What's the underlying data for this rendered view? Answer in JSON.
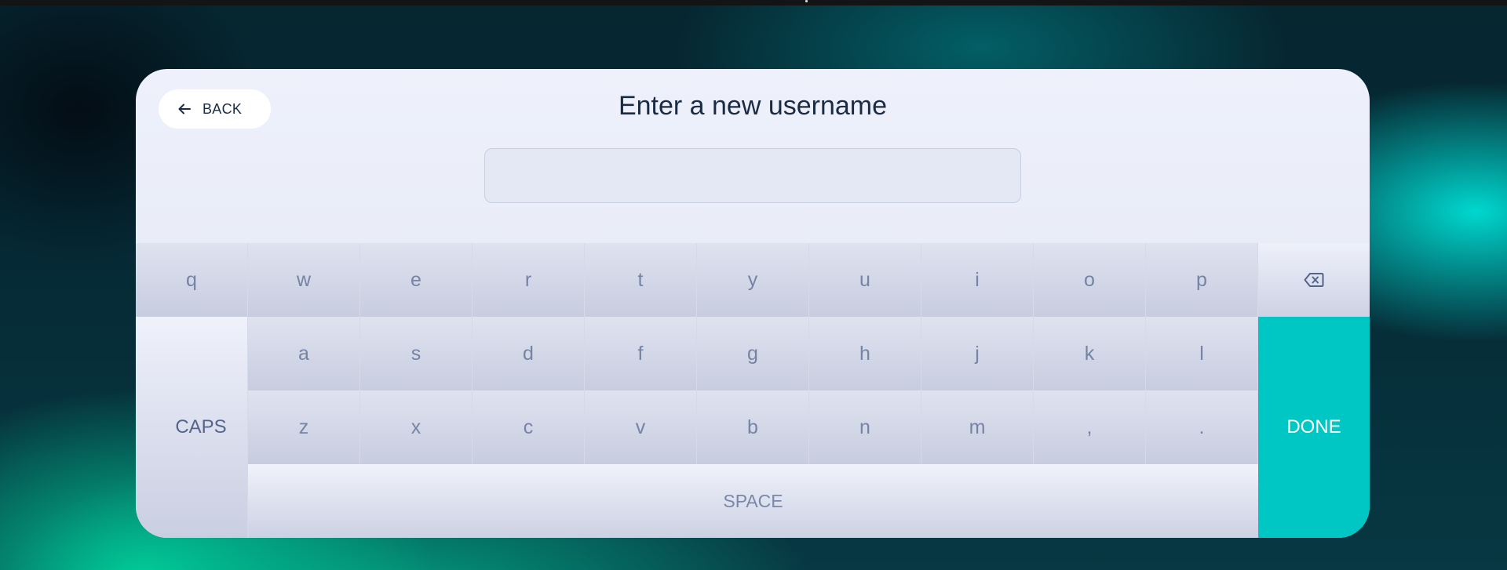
{
  "colors": {
    "accent": "#00c6c4",
    "title_text": "#1b2b44",
    "key_text": "#7584a4"
  },
  "header": {
    "back_label": "BACK",
    "back_icon": "arrow-left-icon",
    "title": "Enter a new username"
  },
  "input": {
    "value": "",
    "placeholder": ""
  },
  "keyboard": {
    "row1": [
      "q",
      "w",
      "e",
      "r",
      "t",
      "y",
      "u",
      "i",
      "o",
      "p"
    ],
    "row2": [
      "a",
      "s",
      "d",
      "f",
      "g",
      "h",
      "j",
      "k",
      "l"
    ],
    "row3": [
      "z",
      "x",
      "c",
      "v",
      "b",
      "n",
      "m",
      ",",
      "."
    ],
    "backspace_icon": "backspace-icon",
    "caps_label": "CAPS",
    "done_label": "DONE",
    "space_label": "SPACE"
  }
}
